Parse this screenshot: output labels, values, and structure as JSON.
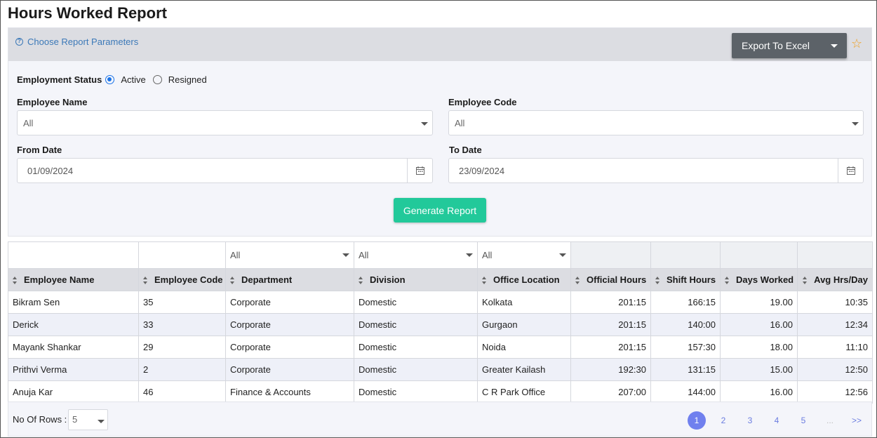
{
  "page": {
    "title": "Hours Worked Report"
  },
  "params": {
    "choose_label": "Choose Report Parameters",
    "export_label": "Export To Excel",
    "employment_status_label": "Employment Status",
    "status_options": [
      "Active",
      "Resigned"
    ],
    "status_selected": "Active",
    "employee_name_label": "Employee Name",
    "employee_name_value": "All",
    "employee_code_label": "Employee Code",
    "employee_code_value": "All",
    "from_date_label": "From Date",
    "from_date_value": "01/09/2024",
    "to_date_label": "To Date",
    "to_date_value": "23/09/2024",
    "generate_label": "Generate Report"
  },
  "table": {
    "filters": {
      "department": "All",
      "division": "All",
      "office_location": "All"
    },
    "columns": [
      "Employee Name",
      "Employee Code",
      "Department",
      "Division",
      "Office Location",
      "Official Hours",
      "Shift Hours",
      "Days Worked",
      "Avg Hrs/Day"
    ],
    "rows": [
      [
        "Bikram Sen",
        "35",
        "Corporate",
        "Domestic",
        "Kolkata",
        "201:15",
        "166:15",
        "19.00",
        "10:35"
      ],
      [
        "Derick",
        "33",
        "Corporate",
        "Domestic",
        "Gurgaon",
        "201:15",
        "140:00",
        "16.00",
        "12:34"
      ],
      [
        "Mayank Shankar",
        "29",
        "Corporate",
        "Domestic",
        "Noida",
        "201:15",
        "157:30",
        "18.00",
        "11:10"
      ],
      [
        "Prithvi Verma",
        "2",
        "Corporate",
        "Domestic",
        "Greater Kailash",
        "192:30",
        "131:15",
        "15.00",
        "12:50"
      ],
      [
        "Anuja Kar",
        "46",
        "Finance & Accounts",
        "Domestic",
        "C R Park Office",
        "207:00",
        "144:00",
        "16.00",
        "12:56"
      ]
    ]
  },
  "footer": {
    "rows_label": "No Of Rows :",
    "rows_value": "5",
    "pages": [
      "1",
      "2",
      "3",
      "4",
      "5",
      "...",
      ">>"
    ],
    "current_page": "1"
  },
  "colors": {
    "accent_green": "#22c99a",
    "link_blue": "#3c79b8",
    "page_active": "#7080ee",
    "star": "#f0a020"
  }
}
